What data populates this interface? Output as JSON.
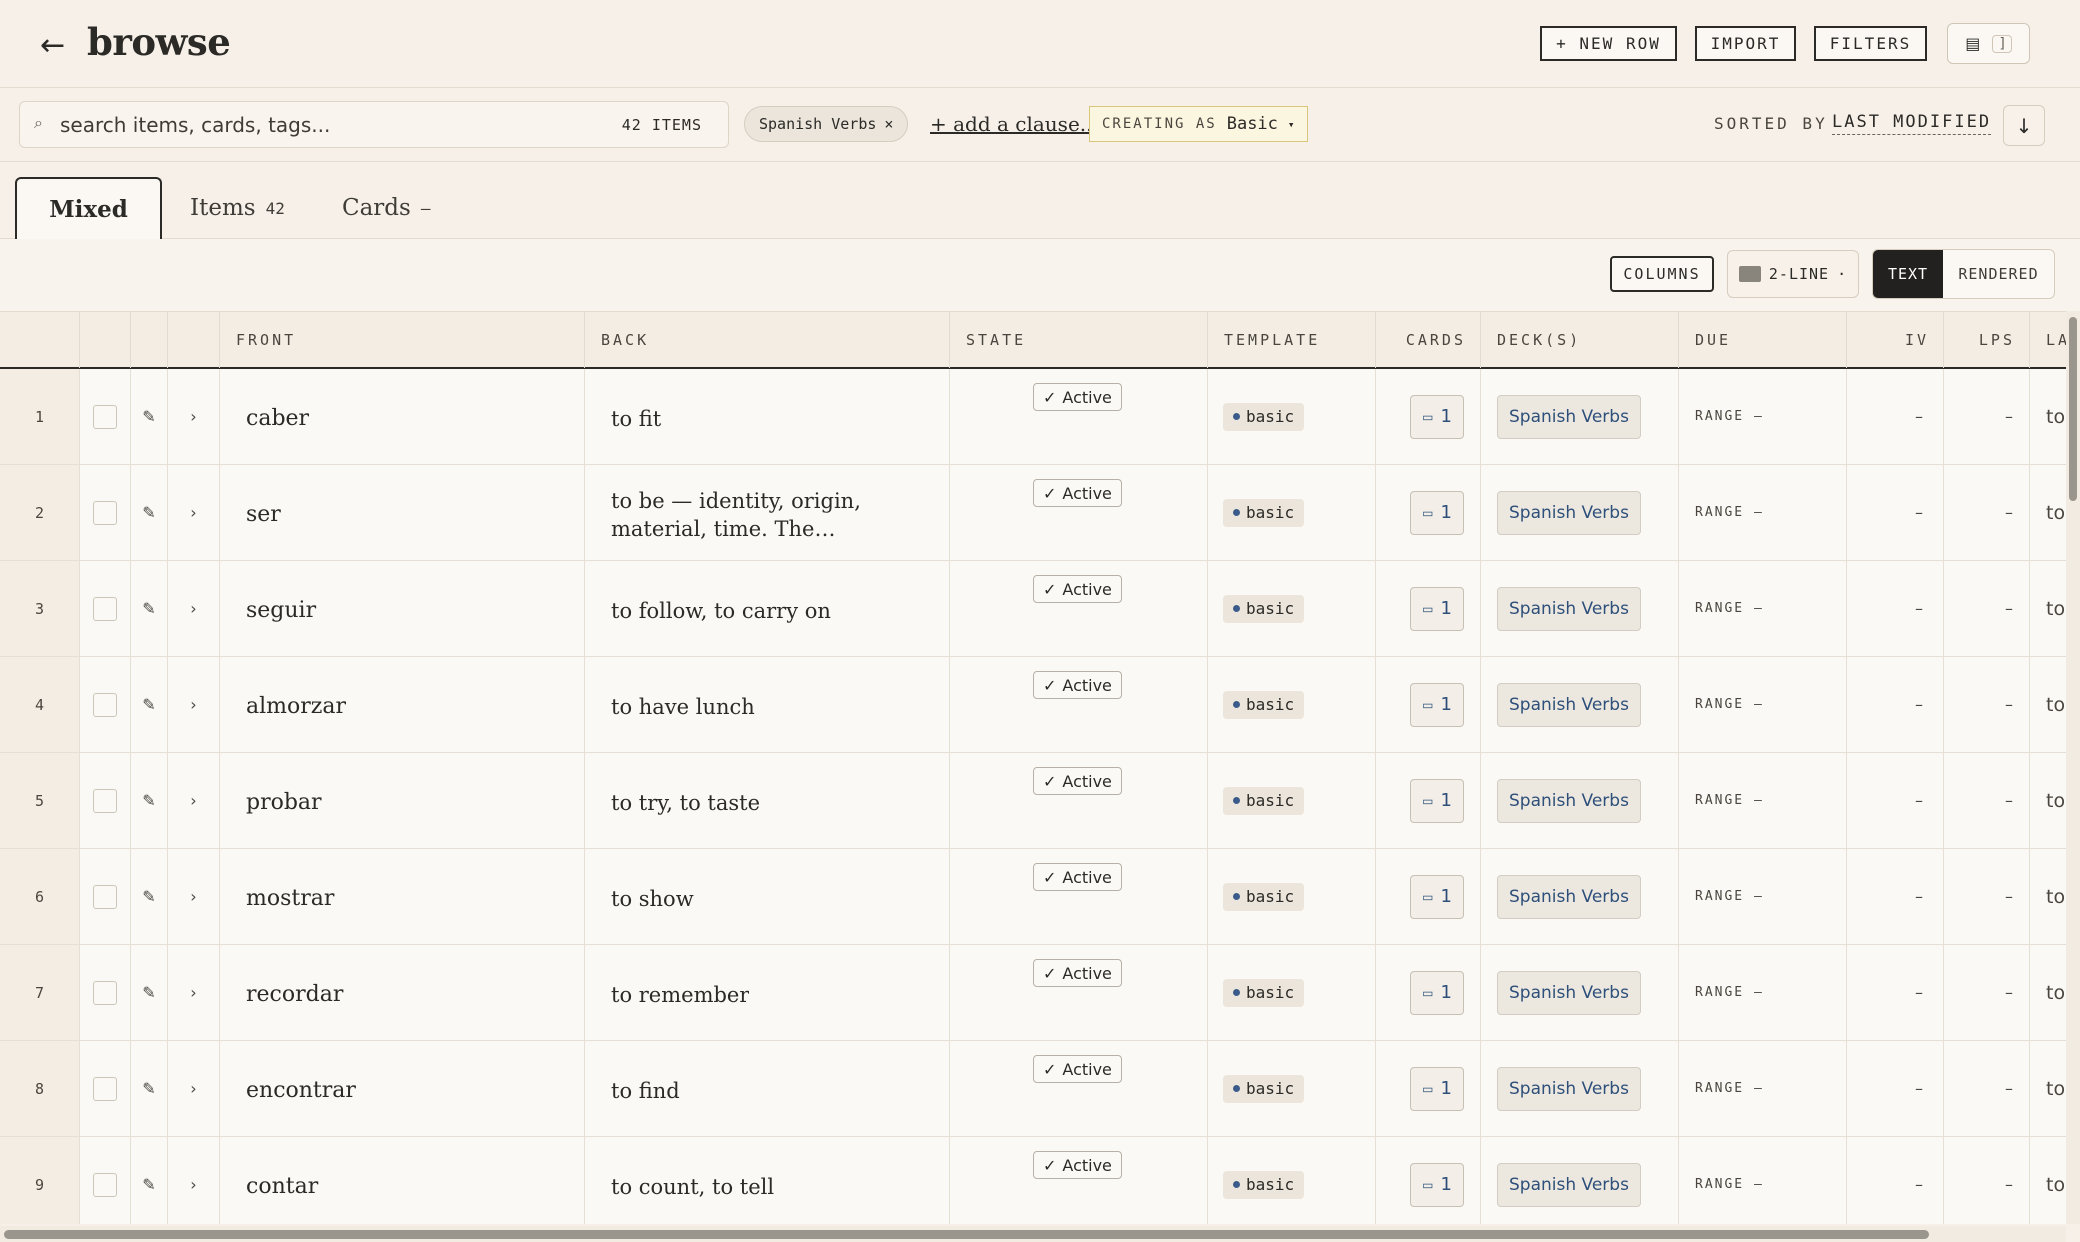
{
  "header": {
    "title": "browse",
    "new_row_label": "+ NEW ROW",
    "import_label": "IMPORT",
    "filters_label": "FILTERS",
    "panel_toggle_bracket": "]"
  },
  "filterbar": {
    "search_placeholder": "search items, cards, tags...",
    "items_count": "42 ITEMS",
    "chip_label": "Spanish Verbs",
    "chip_close": "×",
    "add_clause": "+ add a clause...",
    "creating_label": "CREATING AS",
    "creating_value": "Basic",
    "creating_caret": "▾",
    "sorted_label": "SORTED BY",
    "sorted_value": "LAST MODIFIED"
  },
  "tabs": [
    {
      "label": "Mixed",
      "count": ""
    },
    {
      "label": "Items",
      "count": "42"
    },
    {
      "label": "Cards",
      "count": "–"
    }
  ],
  "toolbar": {
    "columns_label": "COLUMNS",
    "density_label": "2-LINE",
    "density_caret": "·",
    "view_text": "TEXT",
    "view_rendered": "RENDERED"
  },
  "columns": {
    "front": "FRONT",
    "back": "BACK",
    "state": "STATE",
    "template": "TEMPLATE",
    "cards": "CARDS",
    "decks": "DECK(S)",
    "due": "DUE",
    "iv": "IV",
    "lps": "LPS",
    "la": "LA"
  },
  "rows": [
    {
      "num": "1",
      "front": "caber",
      "back": "to fit",
      "state": "Active",
      "template": "basic",
      "cards": "1",
      "deck": "Spanish Verbs",
      "due": "RANGE —",
      "iv": "–",
      "lps": "–",
      "la": "to"
    },
    {
      "num": "2",
      "front": "ser",
      "back": "to be — identity, origin, material, time. The permanent one",
      "state": "Active",
      "template": "basic",
      "cards": "1",
      "deck": "Spanish Verbs",
      "due": "RANGE —",
      "iv": "–",
      "lps": "–",
      "la": "to"
    },
    {
      "num": "3",
      "front": "seguir",
      "back": "to follow, to carry on",
      "state": "Active",
      "template": "basic",
      "cards": "1",
      "deck": "Spanish Verbs",
      "due": "RANGE —",
      "iv": "–",
      "lps": "–",
      "la": "to"
    },
    {
      "num": "4",
      "front": "almorzar",
      "back": "to have lunch",
      "state": "Active",
      "template": "basic",
      "cards": "1",
      "deck": "Spanish Verbs",
      "due": "RANGE —",
      "iv": "–",
      "lps": "–",
      "la": "to"
    },
    {
      "num": "5",
      "front": "probar",
      "back": "to try, to taste",
      "state": "Active",
      "template": "basic",
      "cards": "1",
      "deck": "Spanish Verbs",
      "due": "RANGE —",
      "iv": "–",
      "lps": "–",
      "la": "to"
    },
    {
      "num": "6",
      "front": "mostrar",
      "back": "to show",
      "state": "Active",
      "template": "basic",
      "cards": "1",
      "deck": "Spanish Verbs",
      "due": "RANGE —",
      "iv": "–",
      "lps": "–",
      "la": "to"
    },
    {
      "num": "7",
      "front": "recordar",
      "back": "to remember",
      "state": "Active",
      "template": "basic",
      "cards": "1",
      "deck": "Spanish Verbs",
      "due": "RANGE —",
      "iv": "–",
      "lps": "–",
      "la": "to"
    },
    {
      "num": "8",
      "front": "encontrar",
      "back": "to find",
      "state": "Active",
      "template": "basic",
      "cards": "1",
      "deck": "Spanish Verbs",
      "due": "RANGE —",
      "iv": "–",
      "lps": "–",
      "la": "to"
    },
    {
      "num": "9",
      "front": "contar",
      "back": "to count, to tell",
      "state": "Active",
      "template": "basic",
      "cards": "1",
      "deck": "Spanish Verbs",
      "due": "RANGE —",
      "iv": "–",
      "lps": "–",
      "la": "to"
    }
  ]
}
